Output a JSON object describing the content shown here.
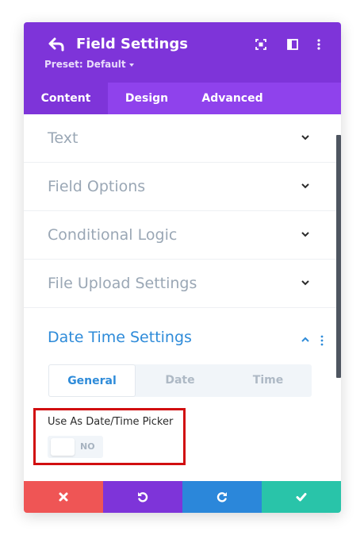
{
  "header": {
    "title": "Field Settings",
    "preset": "Preset: Default",
    "icons": [
      "back-arrow-icon",
      "fullscreen-icon",
      "split-view-icon",
      "more-options-icon"
    ],
    "color": "#7e34d9"
  },
  "tabs": [
    {
      "label": "Content",
      "active": true
    },
    {
      "label": "Design",
      "active": false
    },
    {
      "label": "Advanced",
      "active": false
    }
  ],
  "sections": [
    {
      "label": "Text",
      "expanded": false
    },
    {
      "label": "Field Options",
      "expanded": false
    },
    {
      "label": "Conditional Logic",
      "expanded": false
    },
    {
      "label": "File Upload Settings",
      "expanded": false
    },
    {
      "label": "Date Time Settings",
      "expanded": true
    }
  ],
  "date_time": {
    "subtabs": [
      {
        "label": "General",
        "active": true
      },
      {
        "label": "Date",
        "active": false
      },
      {
        "label": "Time",
        "active": false
      }
    ],
    "option_label": "Use As Date/Time Picker",
    "toggle_value": "NO"
  },
  "footer": {
    "buttons": [
      {
        "name": "discard",
        "icon": "close-icon",
        "color": "#ef5555"
      },
      {
        "name": "undo",
        "icon": "undo-icon",
        "color": "#7e34d9"
      },
      {
        "name": "redo",
        "icon": "redo-icon",
        "color": "#2b87da"
      },
      {
        "name": "save",
        "icon": "check-icon",
        "color": "#29c4a9"
      }
    ]
  },
  "colors": {
    "accent_blue": "#2e8bd9",
    "muted_text": "#9aa7b5",
    "highlight_red": "#d10e10"
  }
}
